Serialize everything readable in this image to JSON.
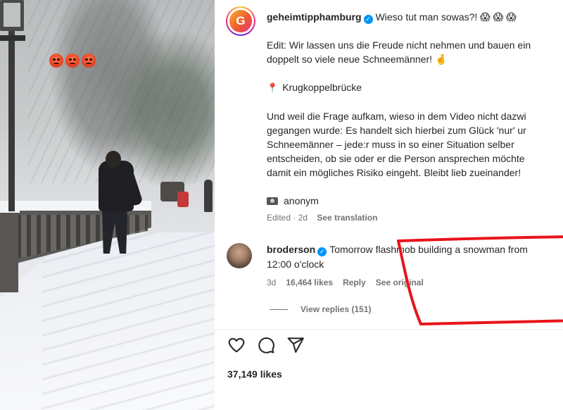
{
  "video": {
    "overlay_emojis": [
      "angry-face",
      "angry-face",
      "angry-face"
    ]
  },
  "post": {
    "username": "geheimtipphamburg",
    "verified": true,
    "title": "Wieso tut man sowas?! 😱 😱 😱",
    "edit_line1": "Edit: Wir lassen uns die Freude nicht nehmen und bauen ein",
    "edit_line2": "doppelt so viele neue Schneemänner! 🤞",
    "location": "Krugkoppelbrücke",
    "body_lines": [
      "Und weil die Frage aufkam, wieso in dem Video nicht dazwi",
      "gegangen wurde: Es handelt sich hierbei zum Glück 'nur' ur",
      "Schneemänner – jede:r muss in so einer Situation selber",
      "entscheiden, ob sie oder er die Person ansprechen möchte",
      "damit ein mögliches Risiko eingeht. Bleibt lieb zueinander!"
    ],
    "credit": "anonym",
    "edited_label": "Edited · 2d",
    "translation_link": "See translation"
  },
  "comment": {
    "username": "broderson",
    "verified": true,
    "text_line1": "Tomorrow flashmob building a snowman from",
    "text_line2": "12:00 o'clock",
    "age": "3d",
    "likes": "16,464 likes",
    "reply_label": "Reply",
    "original_label": "See original",
    "view_replies": "View replies (151)"
  },
  "footer": {
    "likes": "37,149 likes"
  },
  "colors": {
    "verified_badge": "#0095f6",
    "annotation_stroke": "#e8141b",
    "text_primary": "#262626",
    "text_secondary": "#737373"
  },
  "icons": [
    "heart-icon",
    "comment-icon",
    "share-icon",
    "verified-icon",
    "location-pin-icon",
    "camera-icon"
  ]
}
